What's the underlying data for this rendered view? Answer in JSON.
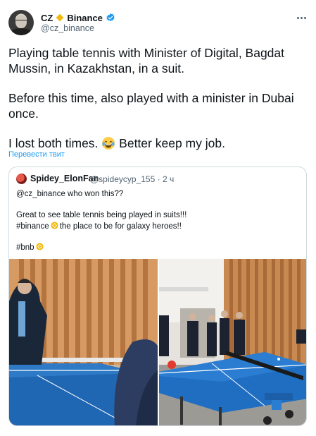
{
  "author": {
    "name": "CZ",
    "affiliation": "Binance",
    "handle": "@cz_binance",
    "avatar_icon": "profile-photo",
    "verified": true
  },
  "tweet": {
    "paragraph_1": "Playing table tennis with Minister of Digital, Bagdat Mussin, in Kazakhstan, in a suit.",
    "paragraph_2": "Before this time, also played with a minister in Dubai once.",
    "paragraph_3a": "I lost both times.",
    "paragraph_3b": "Better keep my job.",
    "emoji": "face-with-tears-of-joy"
  },
  "translate_link": "Перевести твит",
  "quote": {
    "name": "Spidey_ElonFan",
    "handle": "@spideycyp_155",
    "separator": "·",
    "time": "2 ч",
    "line_1": "@cz_binance who won this??",
    "line_2": "Great to see table tennis being played in suits!!!",
    "line_3a": "#binance",
    "line_3b": "the place to be for galaxy heroes!!",
    "line_4": "#bnb"
  },
  "media": {
    "photo_1": "table-tennis-closeup",
    "photo_2": "table-tennis-room"
  },
  "colors": {
    "link": "#1d9bf0",
    "secondary_text": "#536471",
    "binance_yellow": "#f0b90b",
    "border": "#cfd9de"
  }
}
